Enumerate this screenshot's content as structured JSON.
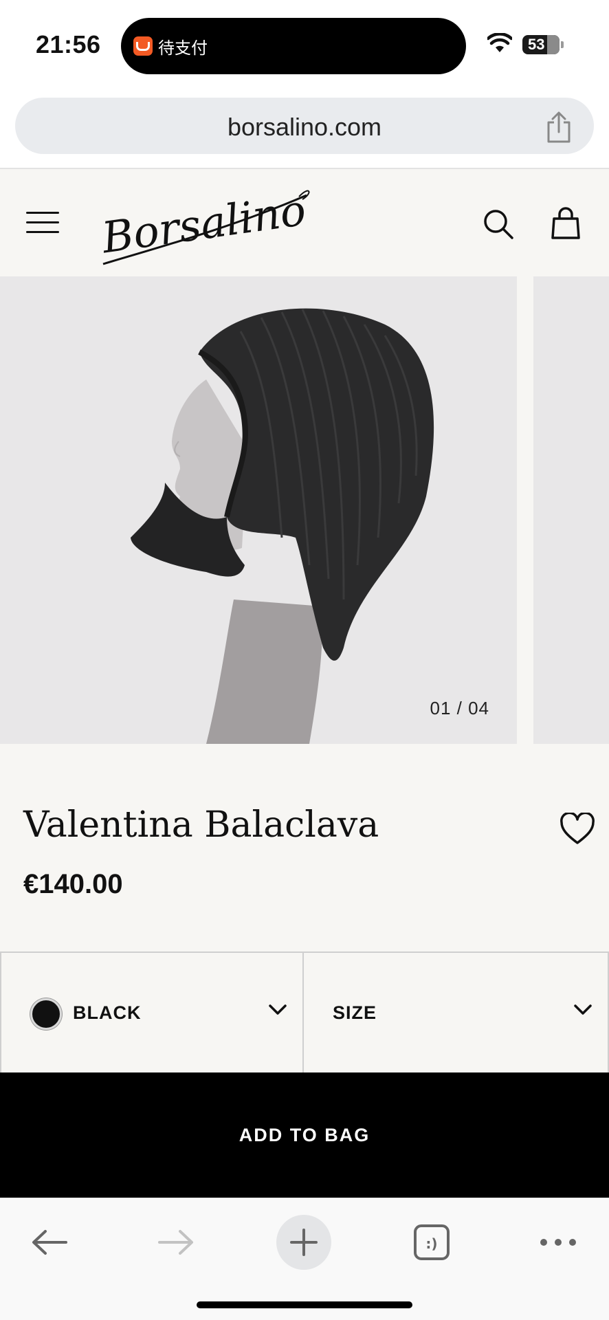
{
  "status_bar": {
    "time": "21:56",
    "island_text": "待支付",
    "battery": "53"
  },
  "browser": {
    "url": "borsalino.com"
  },
  "site": {
    "brand": "Borsalino"
  },
  "gallery": {
    "counter": "01 / 04"
  },
  "product": {
    "title": "Valentina Balaclava",
    "price": "€140.00",
    "color_label": "BLACK",
    "color_hex": "#111111",
    "size_label": "SIZE",
    "add_to_bag": "ADD TO BAG"
  },
  "icons": [
    "menu-icon",
    "search-icon",
    "bag-icon",
    "heart-icon",
    "share-icon",
    "chevron-down-icon",
    "back-arrow-icon",
    "forward-arrow-icon",
    "plus-icon",
    "tabs-icon",
    "more-icon"
  ]
}
